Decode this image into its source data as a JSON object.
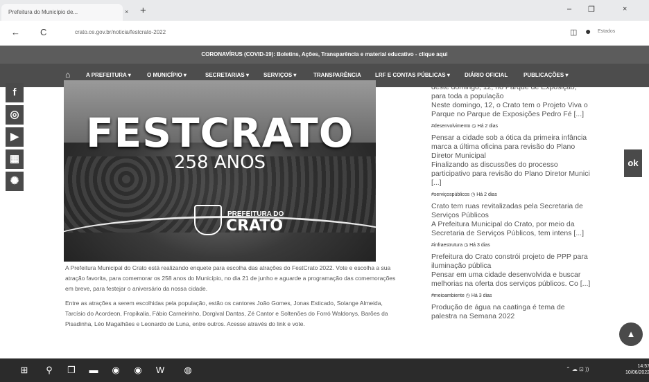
{
  "browser": {
    "tab_title": "Prefeitura do Município de...",
    "close_tab": "×",
    "new_tab": "+",
    "back": "←",
    "reload": "C",
    "url": "crato.ce.gov.br/noticia/festcrato-2022",
    "profile_label": "Estados",
    "win_minimize": "–",
    "win_restore": "❐",
    "win_close": "×"
  },
  "banner": {
    "text": "CORONAVÍRUS (COVID-19): Boletins, Ações, Transparência e material educativo - clique aqui"
  },
  "menu": {
    "home": "⌂",
    "items": [
      {
        "label": "A PREFEITURA ▾"
      },
      {
        "label": "O MUNICÍPIO ▾"
      },
      {
        "label": "SECRETARIAS ▾"
      },
      {
        "label": "SERVIÇOS ▾"
      },
      {
        "label": "TRANSPARÊNCIA"
      },
      {
        "label": "LRF E CONTAS PÚBLICAS ▾"
      },
      {
        "label": "DIÁRIO OFICIAL"
      },
      {
        "label": "PUBLICAÇÕES ▾"
      }
    ]
  },
  "social": {
    "facebook": "f",
    "instagram": "◎",
    "youtube": "▶",
    "app": "▦",
    "other": "✺"
  },
  "hero": {
    "title": "FESTCRATO",
    "subtitle": "258 ANOS",
    "brand_top": "PREFEITURA DO",
    "brand_name": "CRATO"
  },
  "article": {
    "p1": "A Prefeitura Municipal do Crato está realizando enquete para escolha das atrações do FestCrato 2022. Vote e escolha a sua atração favorita, para comemorar os 258 anos do Município, no dia 21 de junho e aguarde a programação das comemorações em breve, para festejar o aniversário da nossa cidade.",
    "p2": "Entre as atrações a serem escolhidas pela população, estão os cantores João Gomes, Jonas Esticado, Solange Almeida, Tarcísio do Acordeon, Fropikalia, Fábio Carneirinho, Dorgival Dantas, Zé Cantor e Soltenões do Forró Waldonys, Barões da Pisadinha, Léo Magalhães e Leonardo de Luna, entre outros. Acesse através do link e vote."
  },
  "news": {
    "item0_title": "deste domingo, 12, no Parque de Exposição, para toda a população",
    "item0_body": "Neste domingo, 12, o Crato tem o Projeto Viva o Parque no Parque de Exposições Pedro Fé [...]",
    "item1_tag": "#desenvolvimento  ◷ Há 2 dias",
    "item1_title": "Pensar a cidade sob a ótica da primeira infância marca a última oficina para revisão do Plano Diretor Municipal",
    "item1_body": "Finalizando as discussões do processo participativo para revisão do Plano Diretor Munici [...]",
    "item2_tag": "#serviçospúblicos  ◷ Há 2 dias",
    "item2_title": "Crato tem ruas revitalizadas pela Secretaria de Serviços Públicos",
    "item2_body": "A Prefeitura Municipal do Crato, por meio da Secretaria de Serviços Públicos, tem intens [...]",
    "item3_tag": "#infraestrutura  ◷ Há 3 dias",
    "item3_title": "Prefeitura do Crato constrói projeto de PPP para iluminação pública",
    "item3_body": "Pensar em uma cidade desenvolvida e buscar melhorias na oferta dos serviços públicos. Co [...]",
    "item4_tag": "#meioambiente  ◷ Há 3 dias",
    "item4_title": "Produção de água na caatinga é tema de palestra na Semana 2022"
  },
  "floating": {
    "side_tab": "ok",
    "to_top": "▲"
  },
  "taskbar": {
    "start": "⊞",
    "search": "⚲",
    "taskview": "❒",
    "tray": "⌃  ☁  ⊡  ))",
    "time": "14:57",
    "date": "10/06/2022"
  }
}
